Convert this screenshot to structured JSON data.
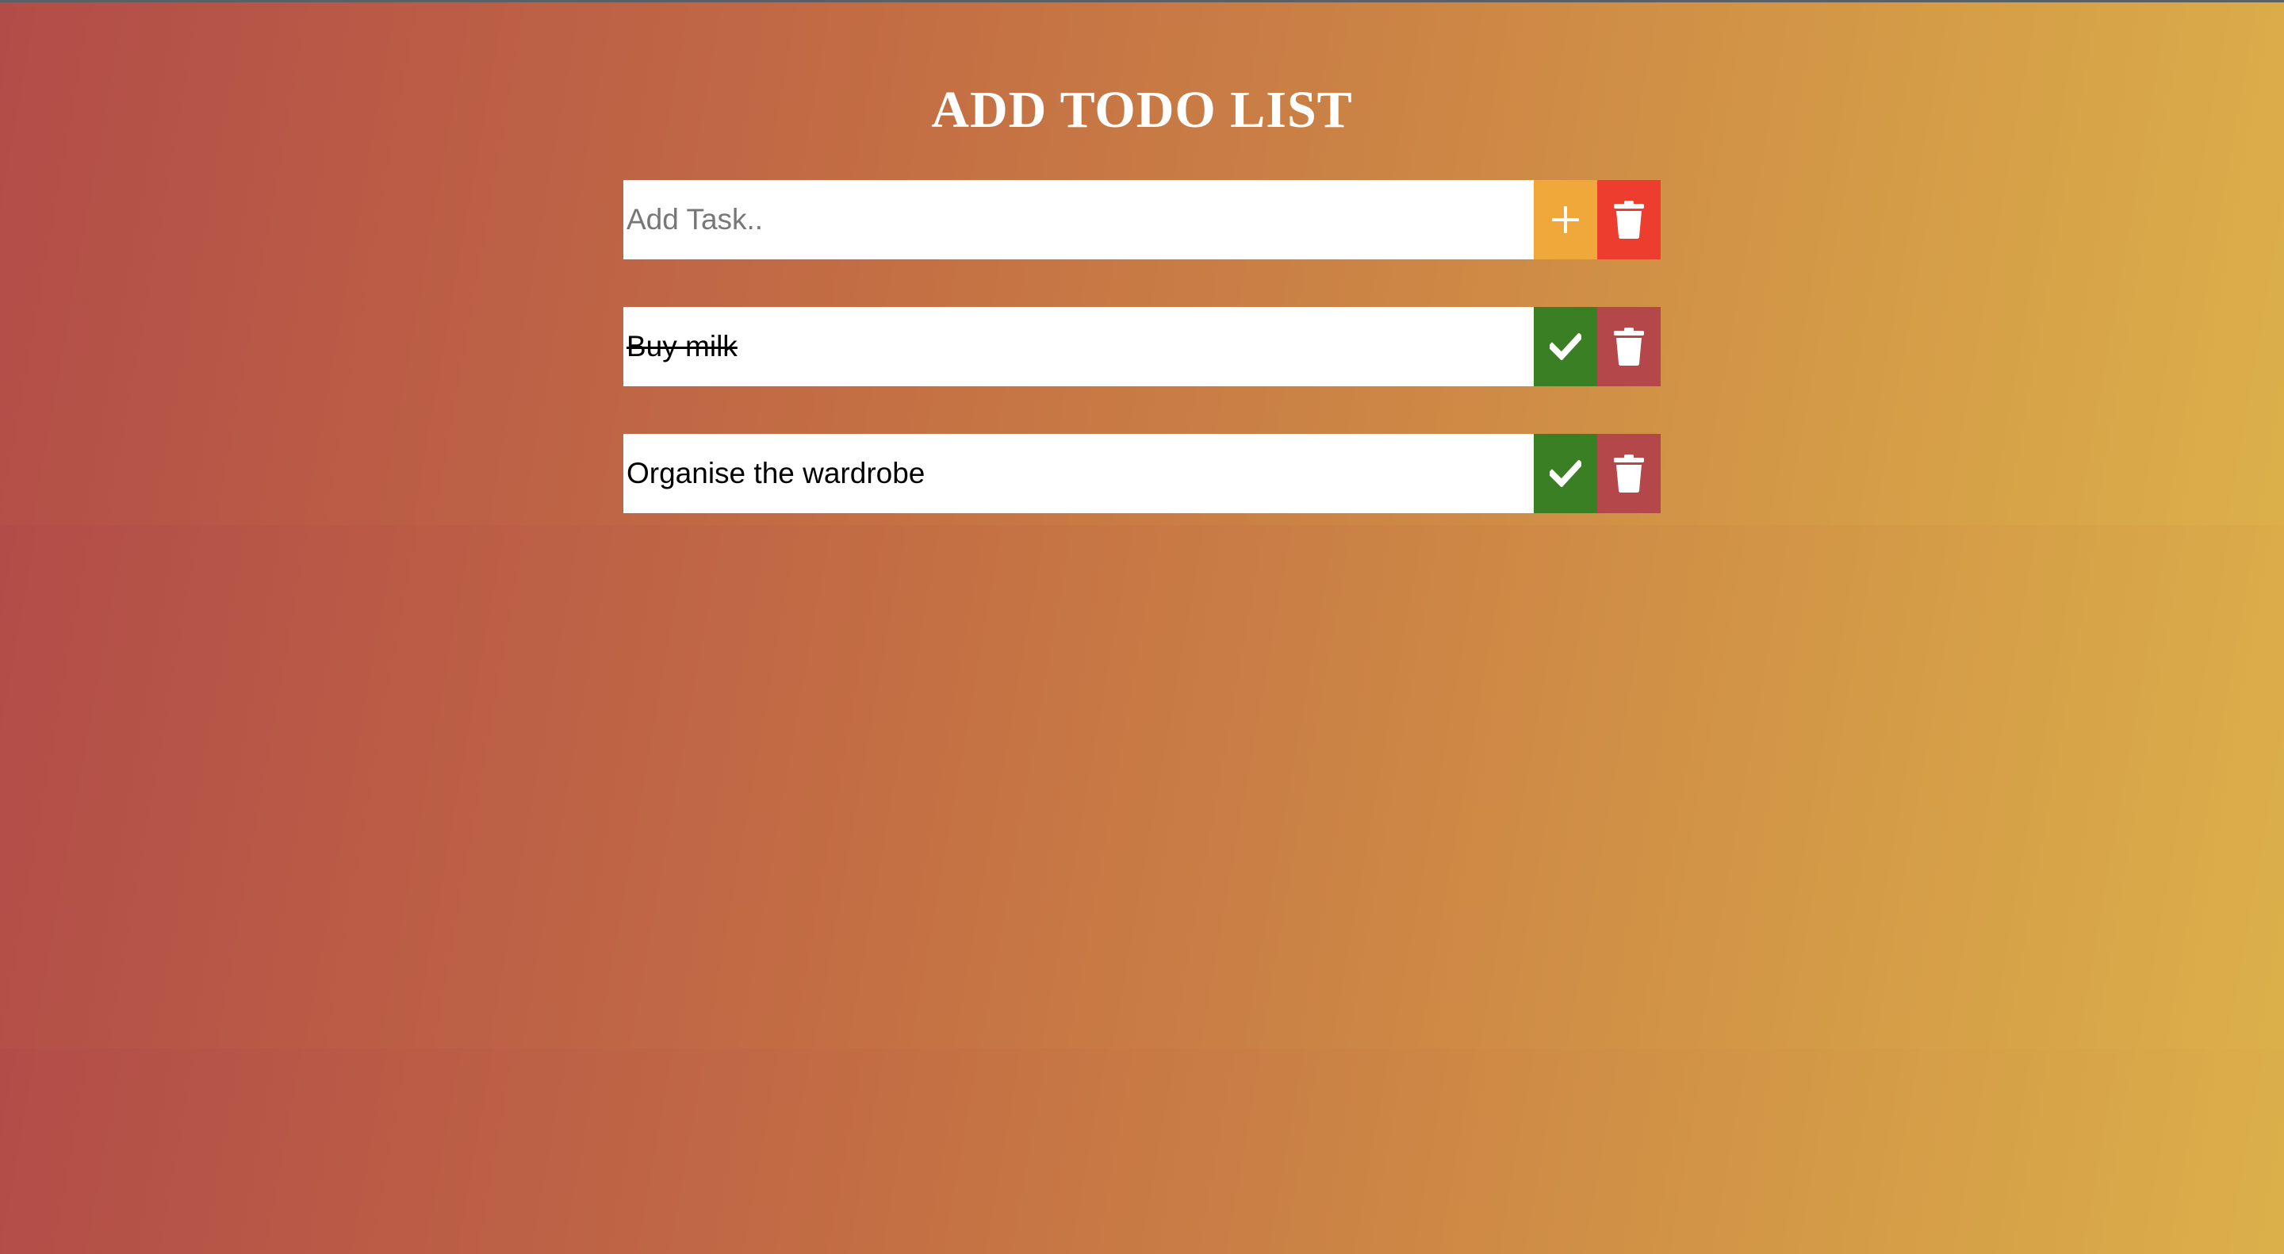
{
  "page": {
    "title": "ADD TODO LIST"
  },
  "new_task": {
    "placeholder": "Add Task..",
    "value": "",
    "add_icon": "plus-icon",
    "clear_icon": "trash-icon"
  },
  "tasks": [
    {
      "text": "Buy milk",
      "completed": true,
      "check_icon": "check-icon",
      "delete_icon": "trash-icon"
    },
    {
      "text": "Organise the wardrobe",
      "completed": false,
      "check_icon": "check-icon",
      "delete_icon": "trash-icon"
    }
  ],
  "colors": {
    "add_button": "#f1a83b",
    "clear_button": "#ec3d2f",
    "check_button": "#3b7f24",
    "delete_button": "#b4474a",
    "title_text": "#ffffff"
  }
}
